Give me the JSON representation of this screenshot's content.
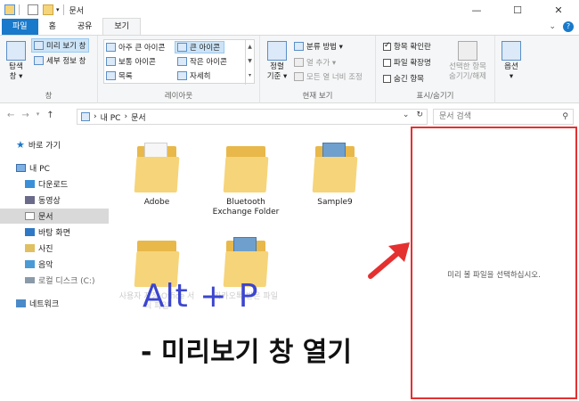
{
  "window": {
    "title": "문서",
    "min_icon": "minimize-icon",
    "max_icon": "maximize-icon",
    "close_icon": "close-icon"
  },
  "tabs": {
    "file": "파일",
    "home": "홈",
    "share": "공유",
    "view": "보기"
  },
  "ribbon": {
    "pane": {
      "nav_pane_label": "탐색",
      "nav_pane_label2": "창 ▾",
      "preview_pane": "미리 보기 창",
      "details_pane": "세부 정보 창",
      "group": "창"
    },
    "layout": {
      "xl_icons": "아주 큰 아이콘",
      "l_icons": "큰 아이콘",
      "m_icons": "보통 아이콘",
      "s_icons": "작은 아이콘",
      "list": "목록",
      "details": "자세히",
      "group": "레이아웃"
    },
    "current_view": {
      "sort_by": "정렬",
      "sort_by2": "기준 ▾",
      "group_by": "분류 방법 ▾",
      "add_columns": "열 추가 ▾",
      "fit_columns": "모든 열 너비 조정",
      "group": "현재 보기"
    },
    "show_hide": {
      "item_checkboxes": "항목 확인란",
      "file_ext": "파일 확장명",
      "hidden_items": "숨긴 항목",
      "hide_selected": "선택한 항목",
      "hide_selected2": "숨기기/해제",
      "group": "표시/숨기기"
    },
    "options": "옵션"
  },
  "address": {
    "path_root": "내 PC",
    "path_leaf": "문서",
    "search_placeholder": "문서 검색"
  },
  "nav": {
    "quick_access": "바로 가기",
    "this_pc": "내 PC",
    "downloads": "다운로드",
    "videos": "동영상",
    "documents": "문서",
    "desktop": "바탕 화면",
    "pictures": "사진",
    "music": "음악",
    "local_disk": "로컬 디스크 (C:)",
    "network": "네트워크"
  },
  "files": [
    {
      "name": "Adobe",
      "doc": "white"
    },
    {
      "name": "Bluetooth Exchange Folder",
      "doc": "none"
    },
    {
      "name": "Sample9",
      "doc": "blue"
    }
  ],
  "files_faded": [
    {
      "name": "사용자 지정 Office 서식 파일",
      "doc": "none"
    },
    {
      "name": "카카오톡 받은 파일",
      "doc": "blue"
    }
  ],
  "preview": {
    "empty_text": "미리 볼 파일을 선택하십시오."
  },
  "annotation": {
    "shortcut": "Alt + P",
    "caption": "- 미리보기 창 열기",
    "color_title": "#3b45d0",
    "color_box": "#e53030"
  }
}
